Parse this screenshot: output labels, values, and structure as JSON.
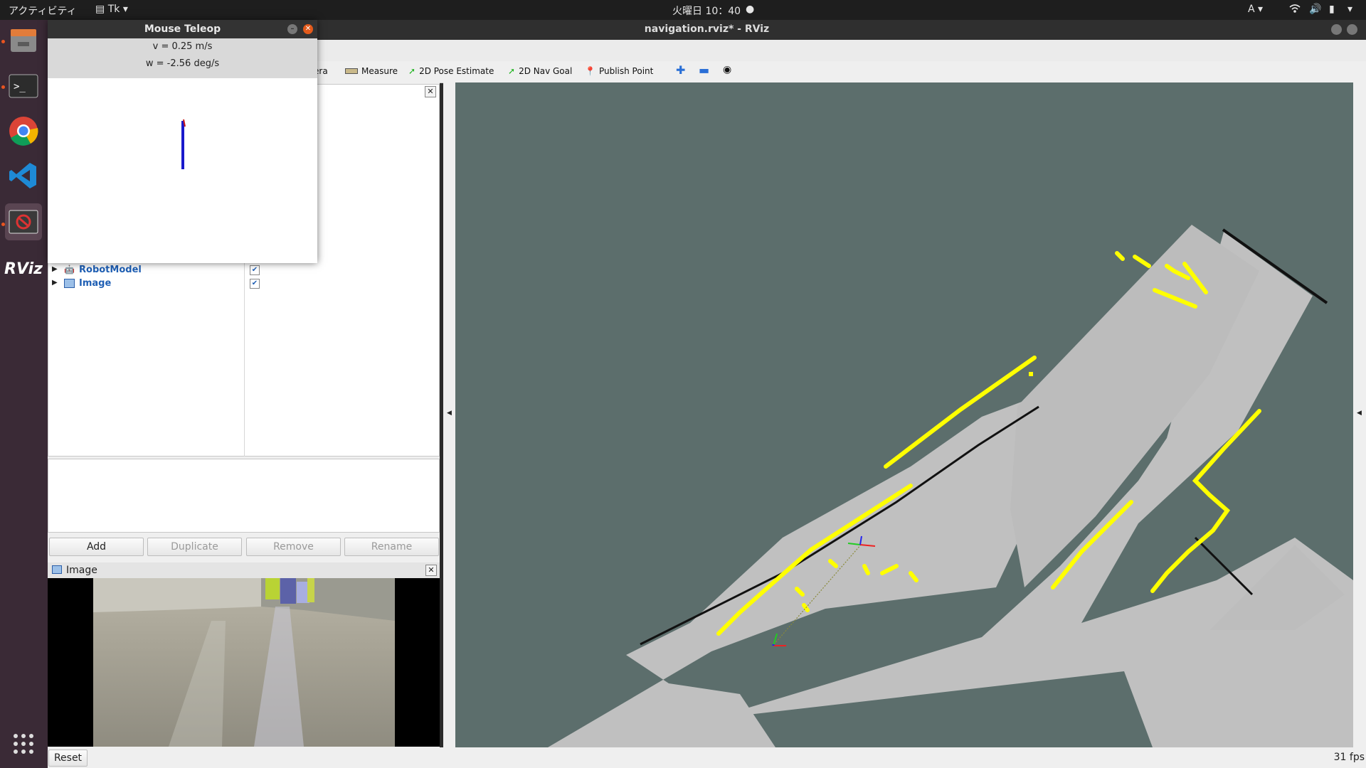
{
  "topbar": {
    "activities": "アクティビティ",
    "app_menu": "Tk",
    "clock": "火曜日 10：40",
    "lang": "A"
  },
  "window": {
    "title": "navigation.rviz* - RViz"
  },
  "toolbar": {
    "camera_fragment": "era",
    "measure": "Measure",
    "pose_estimate": "2D Pose Estimate",
    "nav_goal": "2D Nav Goal",
    "publish_point": "Publish Point"
  },
  "displays": {
    "items": [
      {
        "label": "RobotModel",
        "checked": true
      },
      {
        "label": "Image",
        "checked": true
      }
    ]
  },
  "buttons": {
    "add": "Add",
    "duplicate": "Duplicate",
    "remove": "Remove",
    "rename": "Rename"
  },
  "image_panel": {
    "title": "Image"
  },
  "status": {
    "reset": "Reset",
    "fps": "31 fps"
  },
  "teleop": {
    "title": "Mouse Teleop",
    "v": "v = 0.25 m/s",
    "w": "w = -2.56 deg/s"
  },
  "dock": {
    "apps": [
      "files-icon",
      "terminal-icon",
      "chrome-icon",
      "vscode-icon",
      "blocked-app-icon",
      "rviz-icon"
    ]
  }
}
